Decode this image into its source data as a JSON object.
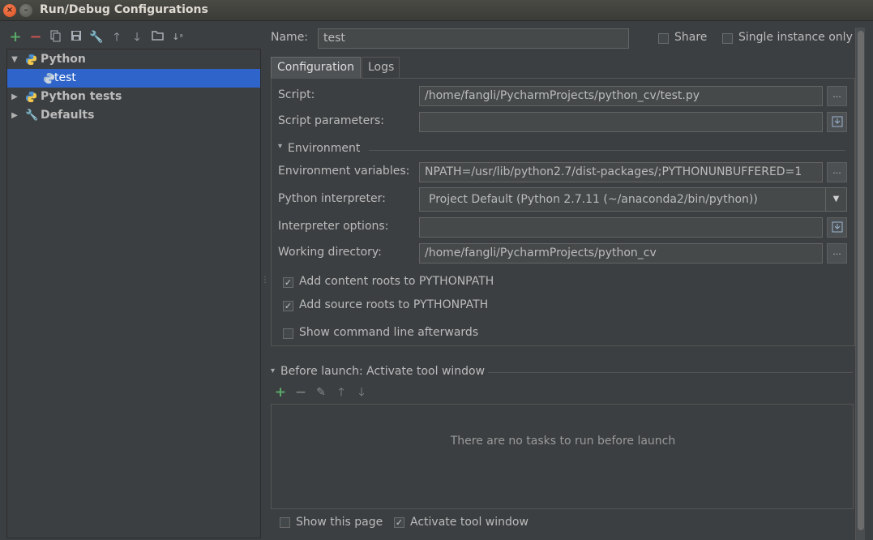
{
  "window": {
    "title": "Run/Debug Configurations"
  },
  "toolbar": {
    "icons": [
      "plus-icon",
      "minus-icon",
      "copy-icon",
      "save-icon",
      "wrench-icon",
      "arrow-up-icon",
      "arrow-down-icon",
      "folder-icon",
      "sort-icon"
    ]
  },
  "tree": {
    "nodes": [
      {
        "label": "Python",
        "expanded": true
      },
      {
        "label": "test",
        "selected": true
      },
      {
        "label": "Python tests",
        "expanded": false
      },
      {
        "label": "Defaults",
        "expanded": false
      }
    ]
  },
  "header": {
    "name_label": "Name:",
    "name_value": "test",
    "share_label": "Share",
    "single_instance_label": "Single instance only"
  },
  "tabs": [
    {
      "label": "Configuration",
      "active": true
    },
    {
      "label": "Logs",
      "active": false
    }
  ],
  "config": {
    "script_label": "Script:",
    "script_value": "/home/fangli/PycharmProjects/python_cv/test.py",
    "script_params_label": "Script parameters:",
    "script_params_value": "",
    "environment_section": "Environment",
    "env_vars_label": "Environment variables:",
    "env_vars_value": "NPATH=/usr/lib/python2.7/dist-packages/;PYTHONUNBUFFERED=1",
    "interpreter_label": "Python interpreter:",
    "interpreter_value": "Project Default (Python 2.7.11 (~/anaconda2/bin/python))",
    "interp_options_label": "Interpreter options:",
    "interp_options_value": "",
    "working_dir_label": "Working directory:",
    "working_dir_value": "/home/fangli/PycharmProjects/python_cv",
    "add_content_roots": "Add content roots to PYTHONPATH",
    "add_source_roots": "Add source roots to PYTHONPATH",
    "show_command_line": "Show command line afterwards",
    "ellipsis": "..."
  },
  "before_launch": {
    "title": "Before launch: Activate tool window",
    "empty": "There are no tasks to run before launch",
    "show_page": "Show this page",
    "activate_tool_window": "Activate tool window"
  },
  "colors": {
    "selection": "#2f65ca",
    "background": "#3c3f41",
    "add_green": "#59a869",
    "remove_red": "#c75450"
  }
}
